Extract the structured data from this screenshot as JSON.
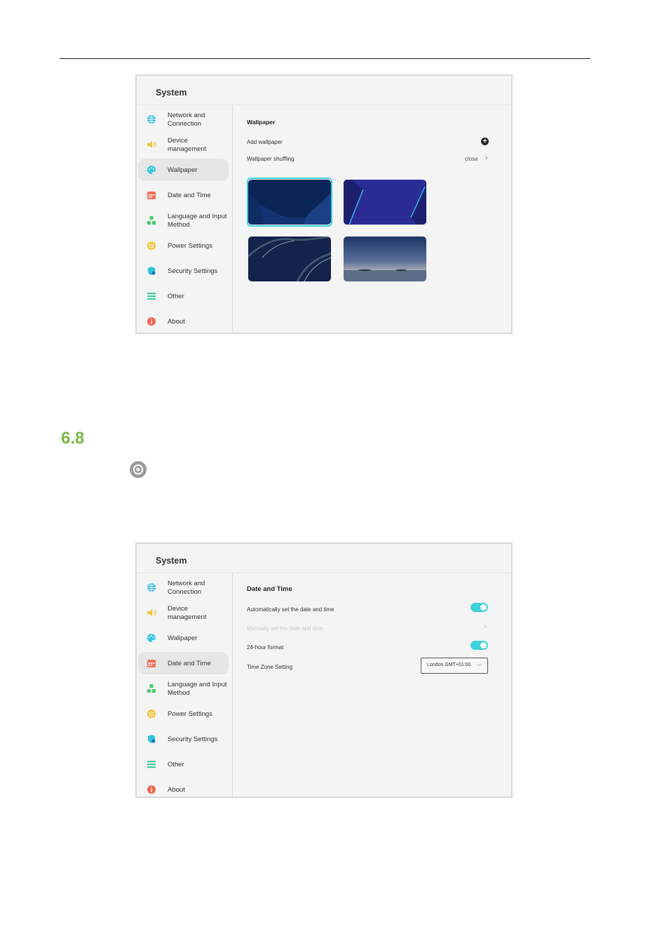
{
  "document": {
    "section_number": "6.8"
  },
  "sidebar_items": [
    {
      "label": "Network and Connection",
      "icon": "globe-icon",
      "color": "#3dbde6"
    },
    {
      "label": "Device management",
      "icon": "speaker-icon",
      "color": "#f3c43a"
    },
    {
      "label": "Wallpaper",
      "icon": "palette-icon",
      "color": "#35c8de"
    },
    {
      "label": "Date and Time",
      "icon": "calendar-icon",
      "color": "#f27059"
    },
    {
      "label": "Language and Input Method",
      "icon": "blocks-icon",
      "color": "#4cc96e"
    },
    {
      "label": "Power Settings",
      "icon": "power-icon",
      "color": "#f3c43a"
    },
    {
      "label": "Security Settings",
      "icon": "shield-icon",
      "color": "#2fc2dd"
    },
    {
      "label": "Other",
      "icon": "list-icon",
      "color": "#45c9a2"
    },
    {
      "label": "About",
      "icon": "info-icon",
      "color": "#ef6650"
    }
  ],
  "panel1": {
    "title": "System",
    "active_item": "Wallpaper",
    "section_title": "Wallpaper",
    "add_wallpaper_label": "Add wallpaper",
    "shuffling_label": "Wallpaper shuffling",
    "shuffling_value": "close",
    "wallpapers": [
      "dark-blue-waves",
      "purple-zigzag",
      "dark-navy-ribbons",
      "dusk-sea-horizon"
    ],
    "selected_wallpaper": "dark-blue-waves"
  },
  "panel2": {
    "title": "System",
    "active_item": "Date and Time",
    "section_title": "Date and Time",
    "auto_label": "Automatically set the date and time",
    "auto_on": true,
    "manual_label": "Manually set the date and time",
    "hour24_label": "24-hour format",
    "hour24_on": true,
    "tz_label": "Time Zone Setting",
    "tz_value": "London GMT+01:00"
  },
  "colors": {
    "accent": "#37d2e0",
    "section_number": "#7ab648"
  }
}
